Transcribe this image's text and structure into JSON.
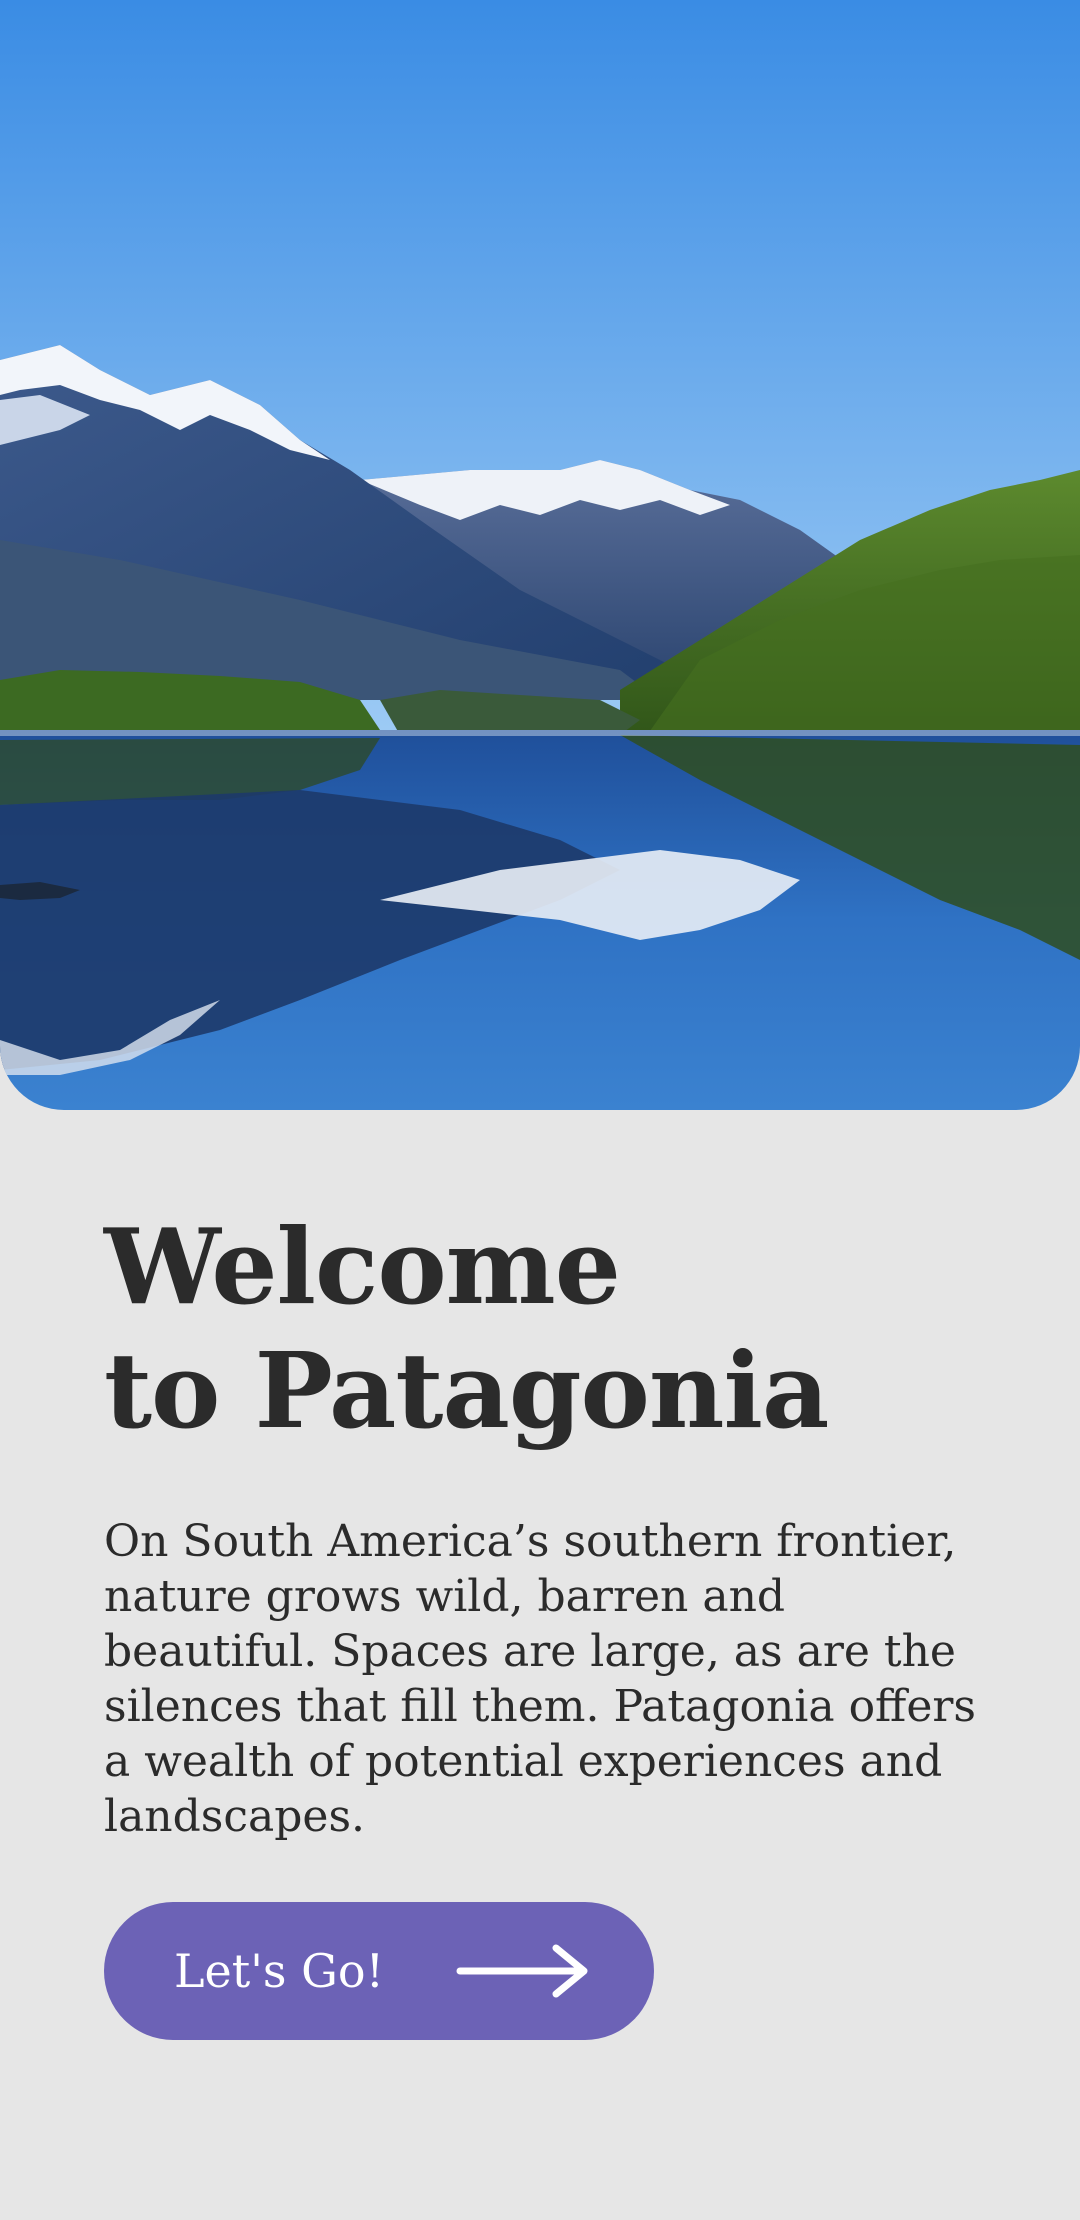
{
  "hero": {
    "image": "patagonia-lake-mountains-photo",
    "colors": {
      "sky_top": "#3a8fe6",
      "sky_bottom": "#8fc4f5",
      "water": "#2e6fbf"
    }
  },
  "welcome": {
    "title_line1": "Welcome",
    "title_line2": "to Patagonia",
    "description": "On South America’s southern frontier, nature grows wild, barren and beautiful. Spaces are large, as are the silences that fill them. Patagonia offers a wealth of potential experiences and landscapes."
  },
  "cta": {
    "label": "Let's Go!",
    "icon": "arrow-right-icon",
    "color": "#6c62b6"
  },
  "background_color": "#e6e6e6"
}
